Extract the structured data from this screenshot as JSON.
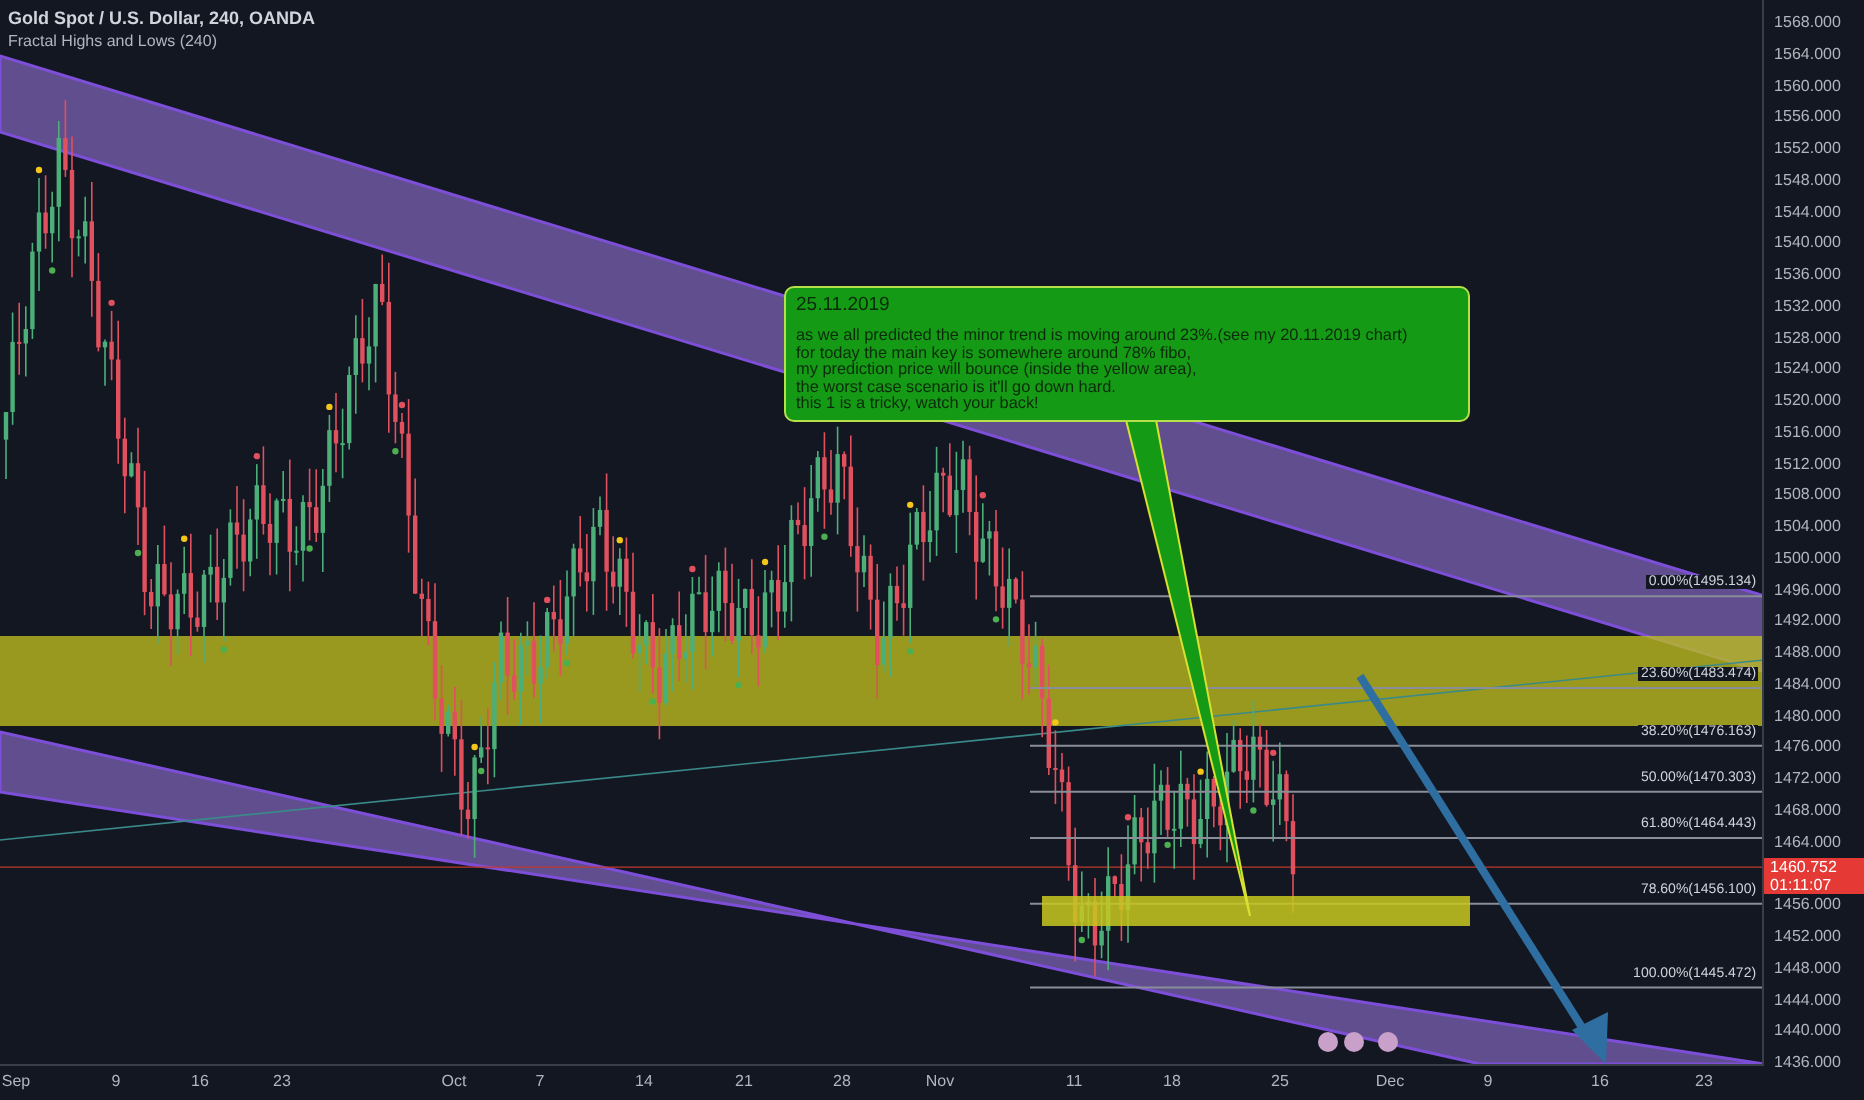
{
  "header": {
    "symbol": "Gold Spot / U.S. Dollar, 240, OANDA",
    "indicator": "Fractal Highs and Lows (240)"
  },
  "note": {
    "date": "25.11.2019",
    "text": "as we all predicted the minor trend is moving around 23%.(see my 20.11.2019 chart)\nfor today the main key is somewhere around 78% fibo,\nmy prediction price will bounce (inside the yellow area),\nthe worst case scenario is it'll go down hard.\nthis 1 is a tricky, watch your back!"
  },
  "fib_levels": [
    {
      "label": "0.00%(1495.134)"
    },
    {
      "label": "23.60%(1483.474)"
    },
    {
      "label": "38.20%(1476.163)"
    },
    {
      "label": "50.00%(1470.303)"
    },
    {
      "label": "61.80%(1464.443)"
    },
    {
      "label": "78.60%(1456.100)"
    },
    {
      "label": "100.00%(1445.472)"
    }
  ],
  "price_axis": {
    "ticks": [
      "1568.000",
      "1564.000",
      "1560.000",
      "1556.000",
      "1552.000",
      "1548.000",
      "1544.000",
      "1540.000",
      "1536.000",
      "1532.000",
      "1528.000",
      "1524.000",
      "1520.000",
      "1516.000",
      "1512.000",
      "1508.000",
      "1504.000",
      "1500.000",
      "1496.000",
      "1492.000",
      "1488.000",
      "1484.000",
      "1480.000",
      "1476.000",
      "1472.000",
      "1468.000",
      "1464.000",
      "1456.000",
      "1452.000",
      "1448.000",
      "1444.000",
      "1440.000",
      "1436.000"
    ],
    "last_price": "1460.752",
    "countdown": "01:11:07"
  },
  "time_axis": {
    "ticks": [
      "Sep",
      "9",
      "16",
      "23",
      "Oct",
      "7",
      "14",
      "21",
      "28",
      "Nov",
      "11",
      "18",
      "25",
      "Dec",
      "9",
      "16",
      "23"
    ]
  }
}
